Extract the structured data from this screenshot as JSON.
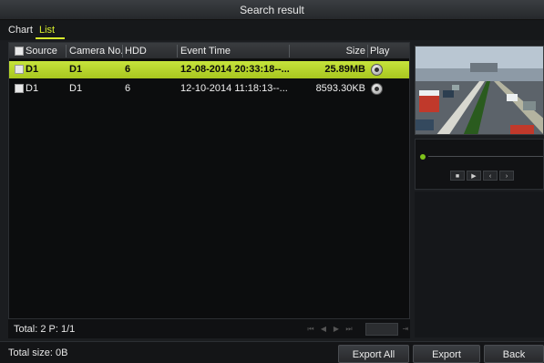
{
  "window": {
    "title": "Search result"
  },
  "tabs": [
    {
      "label": "Chart",
      "active": false
    },
    {
      "label": "List",
      "active": true
    }
  ],
  "table": {
    "columns": [
      "Source",
      "Camera No.",
      "HDD",
      "Event Time",
      "Size",
      "Play"
    ],
    "rows": [
      {
        "source": "D1",
        "camera": "D1",
        "hdd": "6",
        "event_time": "12-08-2014 20:33:18--...",
        "size": "25.89MB",
        "selected": true
      },
      {
        "source": "D1",
        "camera": "D1",
        "hdd": "6",
        "event_time": "12-10-2014 11:18:13--...",
        "size": "8593.30KB",
        "selected": false
      }
    ]
  },
  "footer": {
    "total": "Total: 2  P: 1/1"
  },
  "pager": {
    "first": "⏮",
    "prev": "◀",
    "next": "▶",
    "last": "⏭",
    "go": "⇥"
  },
  "player": {
    "stop": "■",
    "play": "▶",
    "prev": "‹",
    "next": "›"
  },
  "bottom": {
    "total_size": "Total size: 0B",
    "export_all_label": "Export All",
    "export_label": "Export",
    "back_label": "Back"
  },
  "colors": {
    "accent": "#d7ee2c",
    "selected_row": "#b9d62e",
    "status_dot": "#7fc21b"
  }
}
